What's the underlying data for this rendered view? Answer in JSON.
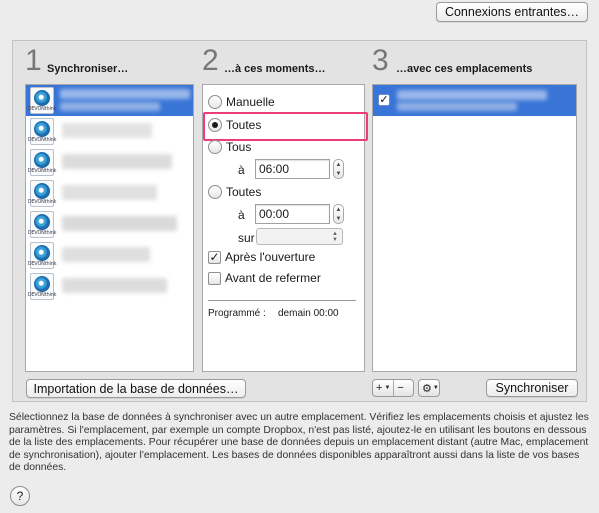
{
  "toolbar": {
    "incoming_button": "Connexions entrantes…"
  },
  "steps": [
    {
      "number": "1",
      "label": "Synchroniser…"
    },
    {
      "number": "2",
      "label": "…à ces moments…"
    },
    {
      "number": "3",
      "label": "…avec ces emplacements"
    }
  ],
  "databases": {
    "icon_caption": "DEVONthink",
    "items_visible": 7,
    "selected_index": 0
  },
  "schedule": {
    "manual": "Manuelle",
    "every": "Toutes",
    "daily": "Tous",
    "at_label_1": "à",
    "time_1": "06:00",
    "weekly": "Toutes",
    "at_label_2": "à",
    "time_2": "00:00",
    "on_label": "sur",
    "day_value": "",
    "after_opening": "Après l'ouverture",
    "after_opening_checked": true,
    "before_closing": "Avant de refermer",
    "before_closing_checked": false,
    "selected_option": "Toutes",
    "scheduled_label": "Programmé :",
    "scheduled_value": "demain 00:00"
  },
  "locations": {
    "checked": true
  },
  "buttons": {
    "import_db": "Importation de la base de données…",
    "synchronize": "Synchroniser",
    "add": "+",
    "remove": "−",
    "gear": "⚙"
  },
  "description": "Sélectionnez la base de données à synchroniser avec  un autre emplacement. Vérifiez les emplacements choisis et ajustez les paramètres. Si l'emplacement, par exemple un compte Dropbox, n'est pas listé, ajoutez-le en utilisant les boutons en dessous de la liste des emplacements. Pour récupérer une base de données depuis un emplacement distant (autre Mac, emplacement de synchronisation), ajouter l'emplacement. Les bases de données disponibles apparaîtront aussi dans la liste de vos bases de données.",
  "help_button": "?",
  "colors": {
    "selection": "#3875d7",
    "highlight_box": "#ec3c7a",
    "window_bg": "#ececec"
  }
}
